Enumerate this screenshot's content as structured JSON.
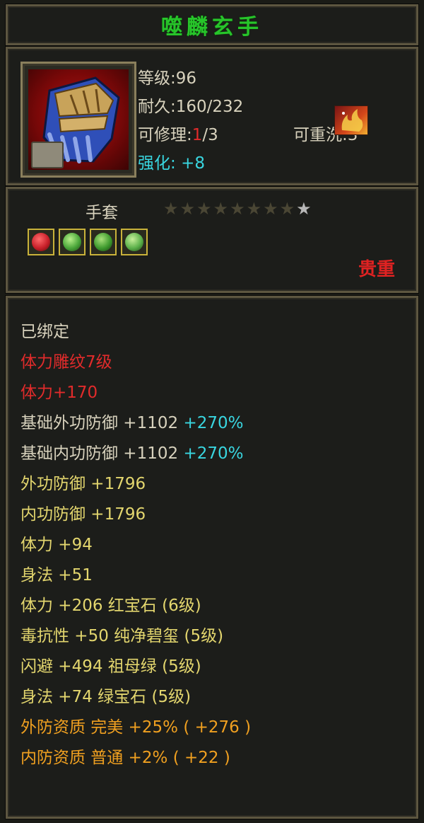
{
  "item": {
    "name": "噬麟玄手",
    "level": "等级:96",
    "durability": {
      "label": "耐久:",
      "value": "160/232"
    },
    "repair": {
      "label": "可修理:",
      "current": "1",
      "total": "/3"
    },
    "rewash": "可重洗:3",
    "enhance": {
      "label": "强化:",
      "value": "+8"
    },
    "type": "手套",
    "stars": {
      "lit": 1,
      "total": 9
    },
    "rarity": "贵重",
    "gems": [
      {
        "name": "ruby-gem",
        "color": "#c8202a"
      },
      {
        "name": "emerald-gem",
        "color": "#4aa63a"
      },
      {
        "name": "jade-gem",
        "color": "#3e9a2e"
      },
      {
        "name": "green-gem",
        "color": "#5bb04a"
      }
    ]
  },
  "attributes": {
    "bound": "已绑定",
    "engrave": "体力雕纹7级",
    "engrave_bonus": "体力+170",
    "base_ext_def": {
      "label": "基础外功防御  +1102",
      "pct": "+270%"
    },
    "base_int_def": {
      "label": "基础内功防御  +1102",
      "pct": "+270%"
    },
    "ext_def": "外功防御  +1796",
    "int_def": "内功防御  +1796",
    "stamina": "体力  +94",
    "agility": "身法  +51",
    "gem_stamina": "体力  +206  红宝石 (6级)",
    "gem_poison": "毒抗性  +50  纯净碧玺 (5级)",
    "gem_dodge": "闪避  +494  祖母绿 (5级)",
    "gem_agility": "身法  +74  绿宝石 (5级)",
    "ext_quality": "外防资质   完美  +25%  ( +276 )",
    "int_quality": "内防资质   普通  +2%  ( +22 )"
  }
}
